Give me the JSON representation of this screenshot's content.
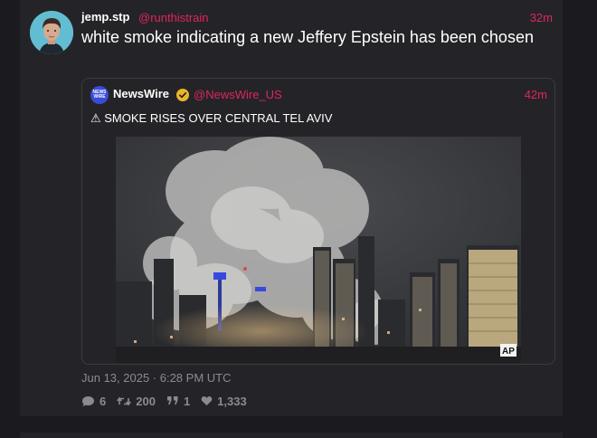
{
  "tweet": {
    "author_name": "jemp.stp",
    "author_handle": "@runthistrain",
    "time": "32m",
    "text": "white smoke indicating a new Jeffery Epstein has been chosen",
    "timestamp": "Jun 13, 2025 · 6:28 PM UTC",
    "stats": {
      "replies": "6",
      "retweets": "200",
      "quotes": "1",
      "likes": "1,333"
    }
  },
  "quote": {
    "avatar_text": "NEWS WIRE",
    "author_name": "NewsWire",
    "author_handle": "@NewsWire_US",
    "time": "42m",
    "text": "⚠ SMOKE RISES OVER CENTRAL TEL AVIV",
    "media_watermark": "AP"
  },
  "colors": {
    "accent": "#e0245e",
    "muted": "#8a8a90",
    "card_bg": "#242428",
    "page_bg": "#1b1b1f",
    "verified": "#e9b52d"
  },
  "icons": {
    "reply": "speech-bubble-icon",
    "retweet": "retweet-icon",
    "quote": "quote-icon",
    "like": "heart-icon",
    "verified": "verified-badge-icon"
  }
}
